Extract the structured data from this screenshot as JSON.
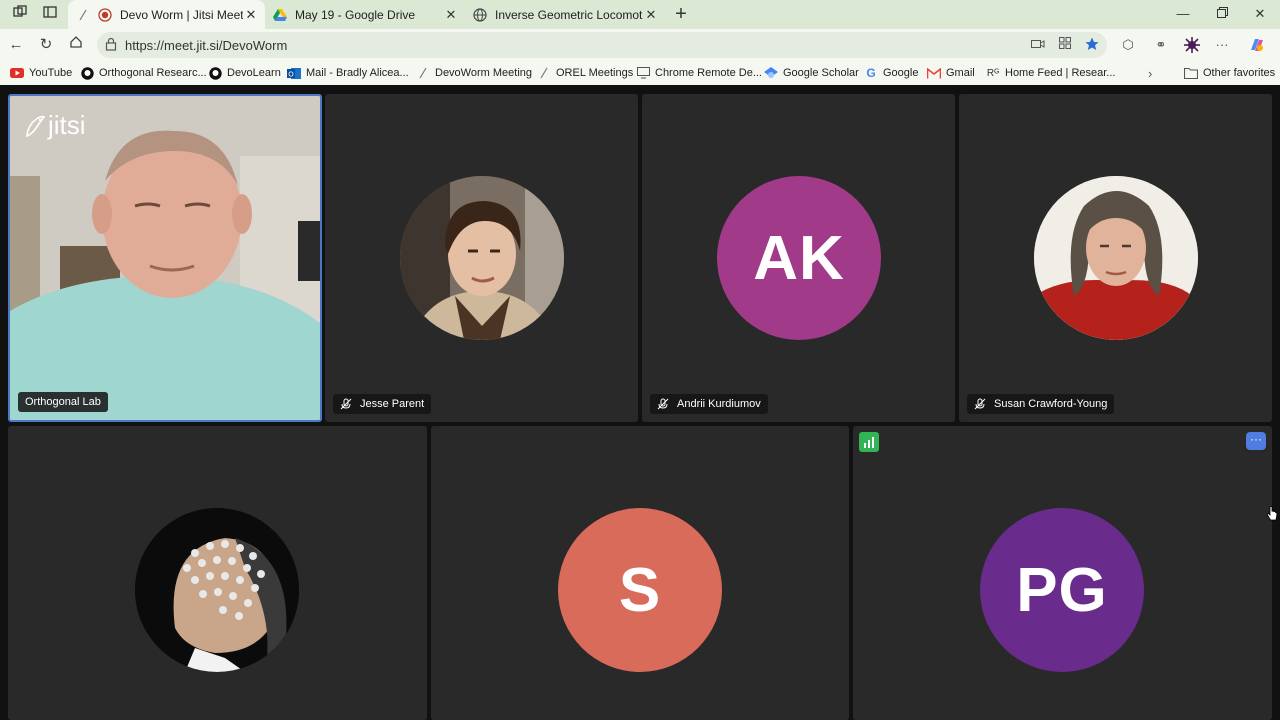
{
  "browser": {
    "tabs": [
      {
        "label": "Devo Worm | Jitsi Meet",
        "active": true,
        "icon": "jitsi-record-icon"
      },
      {
        "label": "May 19 - Google Drive",
        "active": false,
        "icon": "google-drive-icon"
      },
      {
        "label": "Inverse Geometric Locomotion",
        "active": false,
        "icon": "globe-icon"
      }
    ],
    "url": "https://meet.jit.si/DevoWorm",
    "bookmarks": [
      {
        "label": "YouTube",
        "icon": "youtube-icon"
      },
      {
        "label": "Orthogonal Researc...",
        "icon": "github-icon"
      },
      {
        "label": "DevoLearn",
        "icon": "github-icon"
      },
      {
        "label": "Mail - Bradly Alicea...",
        "icon": "outlook-icon"
      },
      {
        "label": "DevoWorm Meeting",
        "icon": "jitsi-icon"
      },
      {
        "label": "OREL Meetings",
        "icon": "jitsi-icon"
      },
      {
        "label": "Chrome Remote De...",
        "icon": "remote-desktop-icon"
      },
      {
        "label": "Google Scholar",
        "icon": "scholar-icon"
      },
      {
        "label": "Google",
        "icon": "google-icon"
      },
      {
        "label": "Gmail",
        "icon": "gmail-icon"
      },
      {
        "label": "Home Feed | Resear...",
        "icon": "researchgate-icon"
      }
    ],
    "other_favorites": "Other favorites"
  },
  "meeting": {
    "logo_text": "jitsi",
    "participants": [
      {
        "name": "Orthogonal Lab",
        "type": "video",
        "muted": false
      },
      {
        "name": "Jesse Parent",
        "type": "photo",
        "muted": true
      },
      {
        "name": "Andrii Kurdiumov",
        "type": "initials",
        "initials": "AK",
        "color": "#a23a8a",
        "muted": true
      },
      {
        "name": "Susan Crawford-Young",
        "type": "photo",
        "muted": true
      },
      {
        "name": "",
        "type": "photo",
        "muted": false
      },
      {
        "name": "",
        "type": "initials",
        "initials": "S",
        "color": "#d96b5b",
        "muted": false
      },
      {
        "name": "",
        "type": "initials",
        "initials": "PG",
        "color": "#6a2c8c",
        "muted": false
      }
    ]
  },
  "colors": {
    "accent": "#4a78c2",
    "tile_bg": "#292929",
    "tabstrip_bg": "#dbe8d3"
  }
}
